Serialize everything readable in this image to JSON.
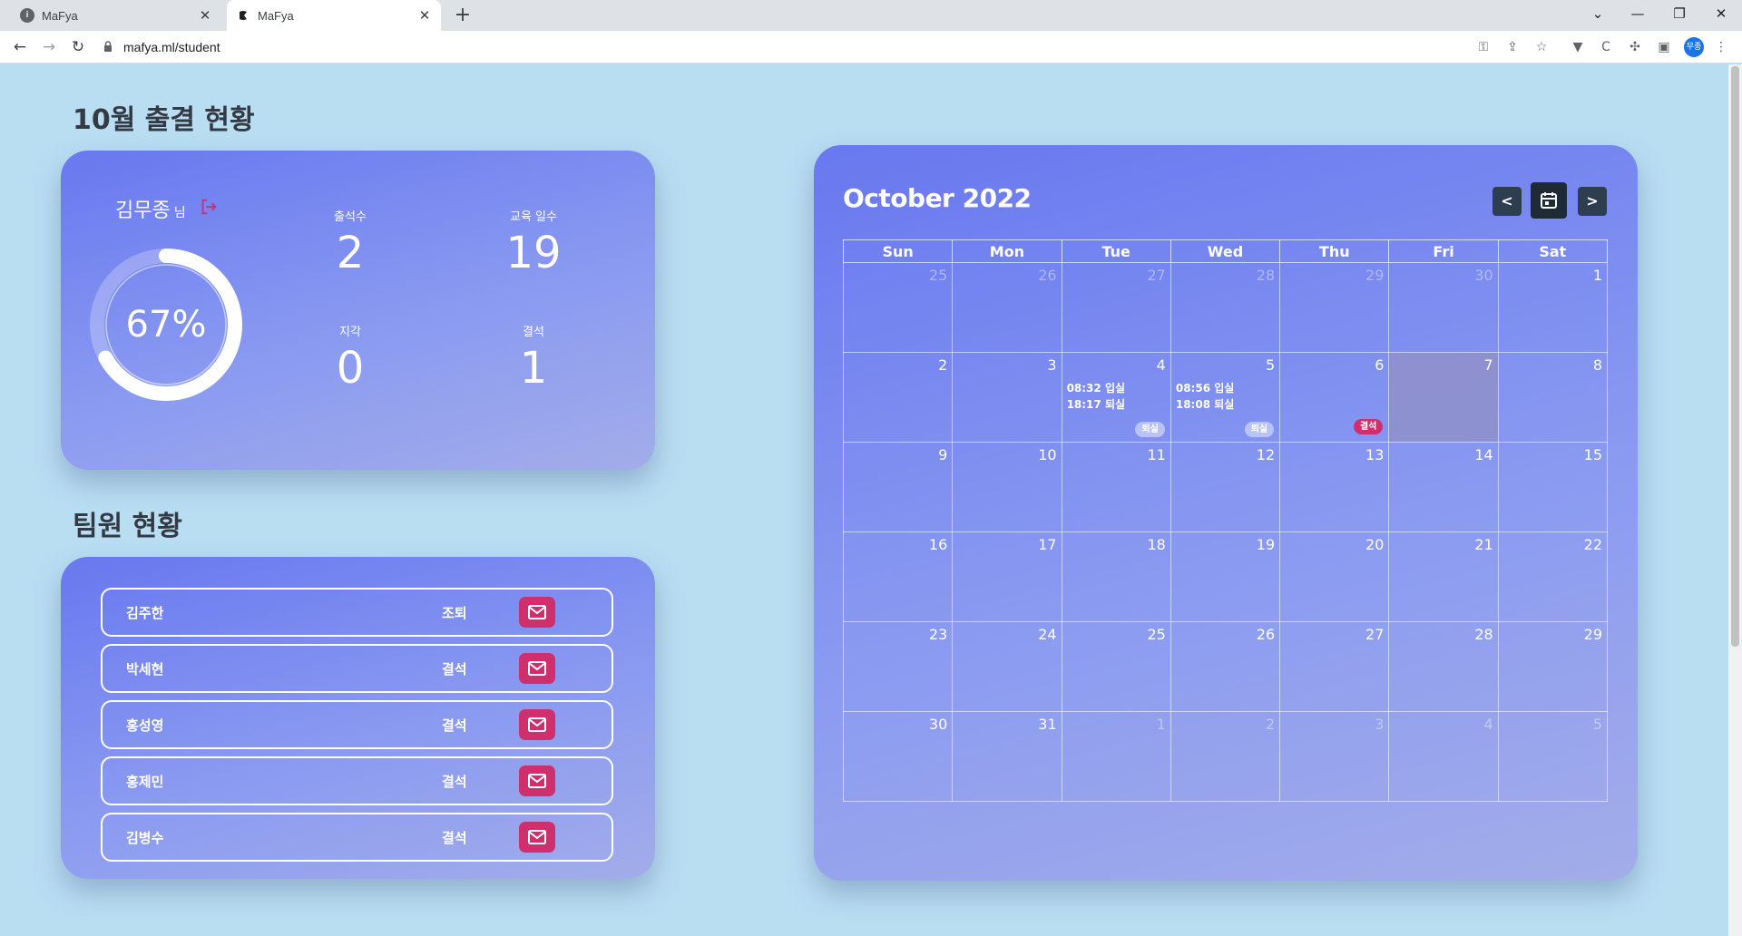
{
  "browser": {
    "tabs": [
      {
        "title": "MaFya",
        "favicon": "info-icon",
        "active": false
      },
      {
        "title": "MaFya",
        "favicon": "mafya-logo-icon",
        "active": true
      }
    ],
    "url": "mafya.ml/student",
    "profile_initials": "무종",
    "icons": {
      "back": "←",
      "forward": "→",
      "reload": "↻",
      "new_tab": "+",
      "close_tab": "✕",
      "minimize": "—",
      "maximize": "❐",
      "close_window": "✕",
      "tab_search": "⌄"
    }
  },
  "attendance": {
    "title": "10월 출결 현황",
    "user_name": "김무종",
    "user_suffix": "님",
    "rate": "67%",
    "rate_fraction": 0.67,
    "stats": [
      {
        "label": "출석수",
        "value": "2"
      },
      {
        "label": "교육 일수",
        "value": "19"
      },
      {
        "label": "지각",
        "value": "0"
      },
      {
        "label": "결석",
        "value": "1"
      }
    ]
  },
  "team": {
    "title": "팀원 현황",
    "members": [
      {
        "name": "김주한",
        "status": "조퇴"
      },
      {
        "name": "박세현",
        "status": "결석"
      },
      {
        "name": "홍성영",
        "status": "결석"
      },
      {
        "name": "홍제민",
        "status": "결석"
      },
      {
        "name": "김병수",
        "status": "결석"
      }
    ]
  },
  "calendar": {
    "title": "October 2022",
    "prev_label": "<",
    "next_label": ">",
    "weekdays": [
      "Sun",
      "Mon",
      "Tue",
      "Wed",
      "Thu",
      "Fri",
      "Sat"
    ],
    "weeks": [
      [
        {
          "d": "25",
          "other": true
        },
        {
          "d": "26",
          "other": true
        },
        {
          "d": "27",
          "other": true
        },
        {
          "d": "28",
          "other": true
        },
        {
          "d": "29",
          "other": true
        },
        {
          "d": "30",
          "other": true
        },
        {
          "d": "1"
        }
      ],
      [
        {
          "d": "2"
        },
        {
          "d": "3"
        },
        {
          "d": "4",
          "times": [
            "08:32 입실",
            "18:17 퇴실"
          ],
          "badge": "퇴실",
          "badge_type": "leave"
        },
        {
          "d": "5",
          "times": [
            "08:56 입실",
            "18:08 퇴실"
          ],
          "badge": "퇴실",
          "badge_type": "leave"
        },
        {
          "d": "6",
          "badge": "결석",
          "badge_type": "absent"
        },
        {
          "d": "7",
          "today": true
        },
        {
          "d": "8"
        }
      ],
      [
        {
          "d": "9"
        },
        {
          "d": "10"
        },
        {
          "d": "11"
        },
        {
          "d": "12"
        },
        {
          "d": "13"
        },
        {
          "d": "14"
        },
        {
          "d": "15"
        }
      ],
      [
        {
          "d": "16"
        },
        {
          "d": "17"
        },
        {
          "d": "18"
        },
        {
          "d": "19"
        },
        {
          "d": "20"
        },
        {
          "d": "21"
        },
        {
          "d": "22"
        }
      ],
      [
        {
          "d": "23"
        },
        {
          "d": "24"
        },
        {
          "d": "25"
        },
        {
          "d": "26"
        },
        {
          "d": "27"
        },
        {
          "d": "28"
        },
        {
          "d": "29"
        }
      ],
      [
        {
          "d": "30"
        },
        {
          "d": "31"
        },
        {
          "d": "1",
          "other": true
        },
        {
          "d": "2",
          "other": true
        },
        {
          "d": "3",
          "other": true
        },
        {
          "d": "4",
          "other": true
        },
        {
          "d": "5",
          "other": true
        }
      ]
    ]
  },
  "colors": {
    "page_bg": "#b9def2",
    "accent_pink": "#cf2f6d",
    "card_start": "#6878ef",
    "card_end": "#a2ade9",
    "nav_button": "#2c3e50"
  }
}
